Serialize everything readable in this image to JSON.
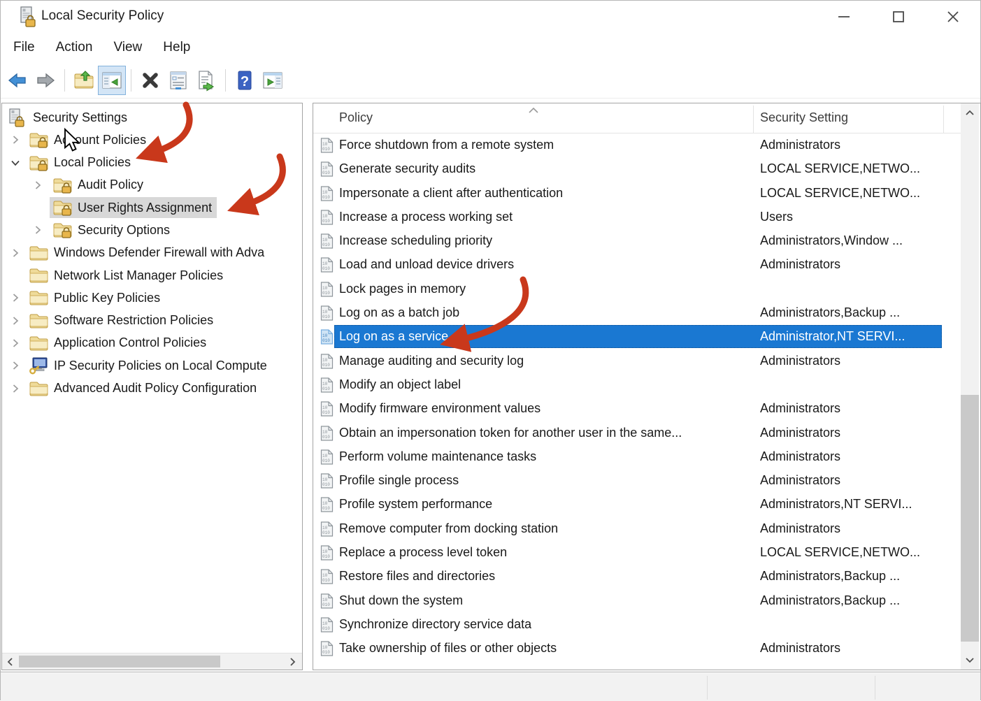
{
  "window": {
    "title": "Local Security Policy"
  },
  "menu": {
    "items": [
      "File",
      "Action",
      "View",
      "Help"
    ]
  },
  "toolbar": {
    "buttons": [
      "back",
      "forward",
      "up-one-level",
      "show-console-tree",
      "delete",
      "properties",
      "export-list",
      "help",
      "show-action-pane"
    ],
    "active_button": "show-console-tree"
  },
  "tree": {
    "items": [
      {
        "label": "Security Settings",
        "level": 0,
        "icon": "root",
        "expander": "none",
        "selected": false
      },
      {
        "label": "Account Policies",
        "level": 1,
        "icon": "folder-lock",
        "expander": "collapsed",
        "selected": false
      },
      {
        "label": "Local Policies",
        "level": 1,
        "icon": "folder-lock",
        "expander": "expanded",
        "selected": false
      },
      {
        "label": "Audit Policy",
        "level": 2,
        "icon": "folder-lock",
        "expander": "collapsed",
        "selected": false
      },
      {
        "label": "User Rights Assignment",
        "level": 2,
        "icon": "folder-lock",
        "expander": "none",
        "selected": true
      },
      {
        "label": "Security Options",
        "level": 2,
        "icon": "folder-lock",
        "expander": "collapsed",
        "selected": false
      },
      {
        "label": "Windows Defender Firewall with Adva",
        "level": 1,
        "icon": "folder",
        "expander": "collapsed",
        "selected": false
      },
      {
        "label": "Network List Manager Policies",
        "level": 1,
        "icon": "folder",
        "expander": "none",
        "selected": false
      },
      {
        "label": "Public Key Policies",
        "level": 1,
        "icon": "folder",
        "expander": "collapsed",
        "selected": false
      },
      {
        "label": "Software Restriction Policies",
        "level": 1,
        "icon": "folder",
        "expander": "collapsed",
        "selected": false
      },
      {
        "label": "Application Control Policies",
        "level": 1,
        "icon": "folder",
        "expander": "collapsed",
        "selected": false
      },
      {
        "label": "IP Security Policies on Local Compute",
        "level": 1,
        "icon": "computer-key",
        "expander": "collapsed",
        "selected": false
      },
      {
        "label": "Advanced Audit Policy Configuration",
        "level": 1,
        "icon": "folder",
        "expander": "collapsed",
        "selected": false
      }
    ]
  },
  "list": {
    "columns": [
      "Policy",
      "Security Setting"
    ],
    "sort": {
      "column": "Policy",
      "direction": "ascending"
    },
    "selected_policy": "Log on as a service",
    "rows": [
      {
        "policy": "Force shutdown from a remote system",
        "setting": "Administrators",
        "selected": false
      },
      {
        "policy": "Generate security audits",
        "setting": "LOCAL SERVICE,NETWO...",
        "selected": false
      },
      {
        "policy": "Impersonate a client after authentication",
        "setting": "LOCAL SERVICE,NETWO...",
        "selected": false
      },
      {
        "policy": "Increase a process working set",
        "setting": "Users",
        "selected": false
      },
      {
        "policy": "Increase scheduling priority",
        "setting": "Administrators,Window ...",
        "selected": false
      },
      {
        "policy": "Load and unload device drivers",
        "setting": "Administrators",
        "selected": false
      },
      {
        "policy": "Lock pages in memory",
        "setting": "",
        "selected": false
      },
      {
        "policy": "Log on as a batch job",
        "setting": "Administrators,Backup ...",
        "selected": false
      },
      {
        "policy": "Log on as a service",
        "setting": "Administrator,NT SERVI...",
        "selected": true
      },
      {
        "policy": "Manage auditing and security log",
        "setting": "Administrators",
        "selected": false
      },
      {
        "policy": "Modify an object label",
        "setting": "",
        "selected": false
      },
      {
        "policy": "Modify firmware environment values",
        "setting": "Administrators",
        "selected": false
      },
      {
        "policy": "Obtain an impersonation token for another user in the same...",
        "setting": "Administrators",
        "selected": false
      },
      {
        "policy": "Perform volume maintenance tasks",
        "setting": "Administrators",
        "selected": false
      },
      {
        "policy": "Profile single process",
        "setting": "Administrators",
        "selected": false
      },
      {
        "policy": "Profile system performance",
        "setting": "Administrators,NT SERVI...",
        "selected": false
      },
      {
        "policy": "Remove computer from docking station",
        "setting": "Administrators",
        "selected": false
      },
      {
        "policy": "Replace a process level token",
        "setting": "LOCAL SERVICE,NETWO...",
        "selected": false
      },
      {
        "policy": "Restore files and directories",
        "setting": "Administrators,Backup ...",
        "selected": false
      },
      {
        "policy": "Shut down the system",
        "setting": "Administrators,Backup ...",
        "selected": false
      },
      {
        "policy": "Synchronize directory service data",
        "setting": "",
        "selected": false
      },
      {
        "policy": "Take ownership of files or other objects",
        "setting": "Administrators",
        "selected": false
      }
    ]
  },
  "annotations": {
    "arrow_color": "#c9381b",
    "arrows_point_to": [
      "Local Policies",
      "User Rights Assignment",
      "Log on as a service"
    ]
  },
  "colors": {
    "selection_blue": "#1a78d2",
    "tree_selection_gray": "#d8d8d8",
    "toolbar_active_bg": "#d3e5f6",
    "toolbar_active_border": "#84b2dc"
  }
}
